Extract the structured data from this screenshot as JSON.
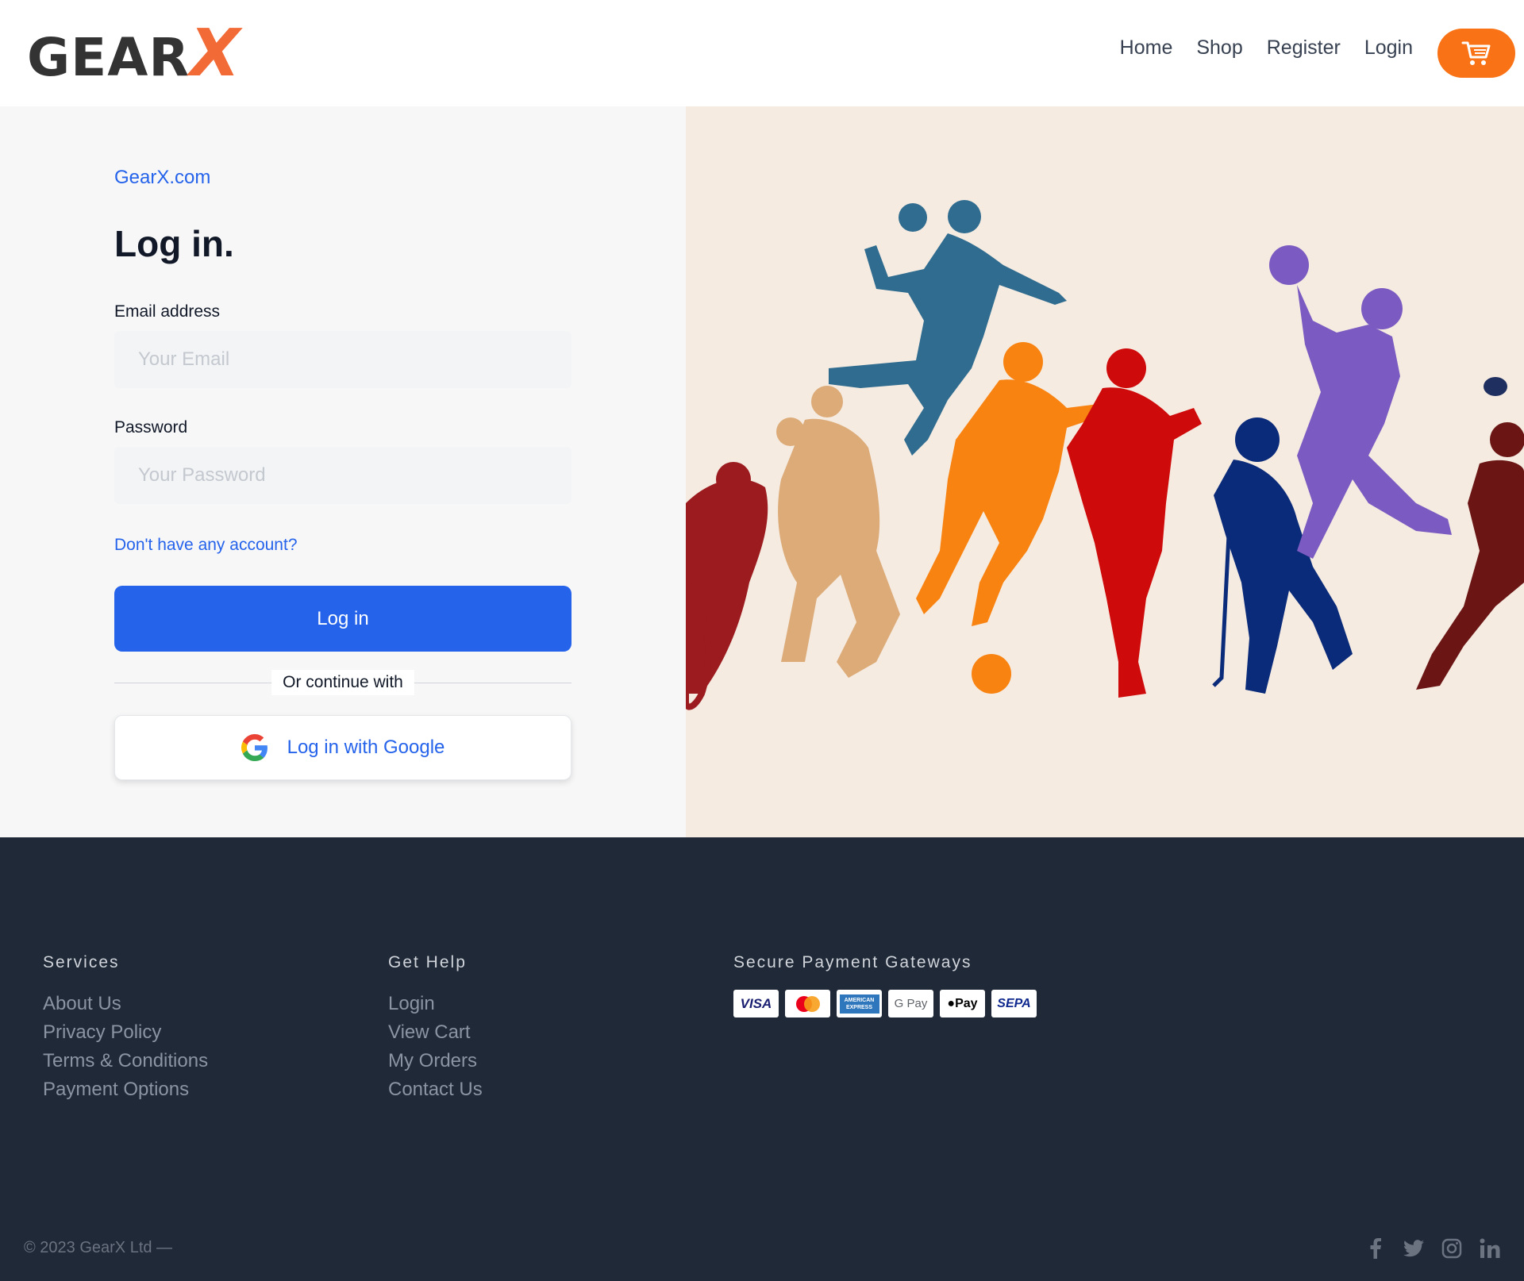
{
  "header": {
    "logo_main": "GEAR",
    "logo_accent": "X",
    "nav": [
      "Home",
      "Shop",
      "Register",
      "Login"
    ],
    "cart_icon": "cart-icon"
  },
  "login": {
    "brand_link": "GearX.com",
    "title": "Log in.",
    "email_label": "Email address",
    "email_placeholder": "Your Email",
    "password_label": "Password",
    "password_placeholder": "Your Password",
    "account_link": "Don't have any account?",
    "submit_label": "Log in",
    "divider_text": "Or continue with",
    "google_label": "Log in with Google"
  },
  "footer": {
    "services": {
      "heading": "Services",
      "links": [
        "About Us",
        "Privacy Policy",
        "Terms & Conditions",
        "Payment Options"
      ]
    },
    "help": {
      "heading": "Get Help",
      "links": [
        "Login",
        "View Cart",
        "My Orders",
        "Contact Us"
      ]
    },
    "payments": {
      "heading": "Secure Payment Gateways",
      "cards": [
        "VISA",
        "",
        "AMERICAN EXPRESS",
        "G Pay",
        "Pay",
        "SEPA"
      ]
    },
    "copyright": "© 2023 GearX Ltd —",
    "socials": [
      "facebook-icon",
      "twitter-icon",
      "instagram-icon",
      "linkedin-icon"
    ]
  },
  "colors": {
    "accent": "#f97316",
    "primary": "#2563eb",
    "footer_bg": "#1f2937",
    "hero_bg": "#f5ebe1"
  }
}
